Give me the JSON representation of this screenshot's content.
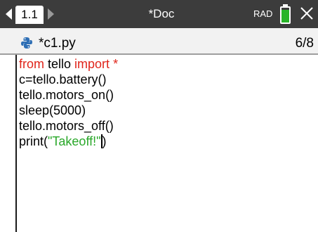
{
  "header": {
    "tab_label": "1.1",
    "doc_title": "*Doc",
    "angle_mode": "RAD",
    "battery_color": "#28b428",
    "battery_level": 0.85,
    "close_icon": "close-icon"
  },
  "file": {
    "icon": "python-icon",
    "name": "*c1.py",
    "line_position": "6/8"
  },
  "code": {
    "line1": {
      "kw1": "from",
      "text": " tello ",
      "kw2": "import",
      "text2": " ",
      "kw3": "*"
    },
    "line2": "c=tello.battery()",
    "line3": "tello.motors_on()",
    "line4": "sleep(5000)",
    "line5": "tello.motors_off()",
    "line6": {
      "pre": "print(",
      "str": "\"Takeoff!\"",
      "post": ")"
    }
  },
  "colors": {
    "keyword": "#e0251b",
    "string": "#2aa82a",
    "title_bar": "#3c3c3c"
  }
}
